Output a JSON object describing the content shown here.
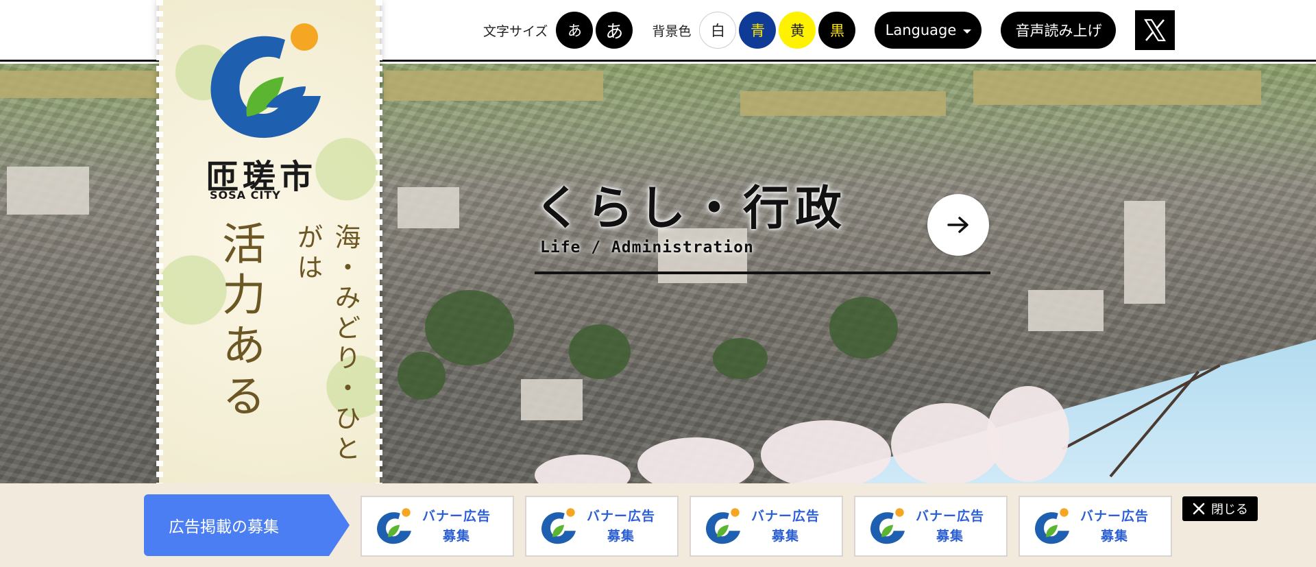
{
  "header": {
    "text_size_label": "文字サイズ",
    "text_size_buttons": [
      "あ",
      "あ"
    ],
    "bg_color_label": "背景色",
    "bg_color_buttons": [
      {
        "label": "白",
        "bg": "#ffffff",
        "fg": "#222222"
      },
      {
        "label": "青",
        "bg": "#0f3b97",
        "fg": "#ffe600"
      },
      {
        "label": "黄",
        "bg": "#fff200",
        "fg": "#222222"
      },
      {
        "label": "黒",
        "bg": "#000000",
        "fg": "#ffe600"
      }
    ],
    "language_label": "Language",
    "voice_label": "音声読み上げ",
    "x_icon": "x-logo-icon"
  },
  "logo": {
    "kanji": "匝瑳市",
    "english": "SOSA CITY",
    "tagline_big": "活力ある",
    "tagline_small": "海・みどり・ひとがは"
  },
  "hero": {
    "title": "くらし・行政",
    "subtitle": "Life / Administration",
    "arrow_icon": "arrow-right-icon"
  },
  "banner": {
    "recruit_label": "広告掲載の募集",
    "ads": [
      {
        "line1": "バナー広告",
        "line2": "募集"
      },
      {
        "line1": "バナー広告",
        "line2": "募集"
      },
      {
        "line1": "バナー広告",
        "line2": "募集"
      },
      {
        "line1": "バナー広告",
        "line2": "募集"
      },
      {
        "line1": "バナー広告",
        "line2": "募集"
      }
    ],
    "close_label": "閉じる"
  },
  "colors": {
    "accent_blue": "#4b7ef2",
    "logo_blue": "#1f5fb0",
    "logo_green": "#5cb531",
    "logo_orange": "#f5a623",
    "banner_text": "#2c5fd6"
  }
}
